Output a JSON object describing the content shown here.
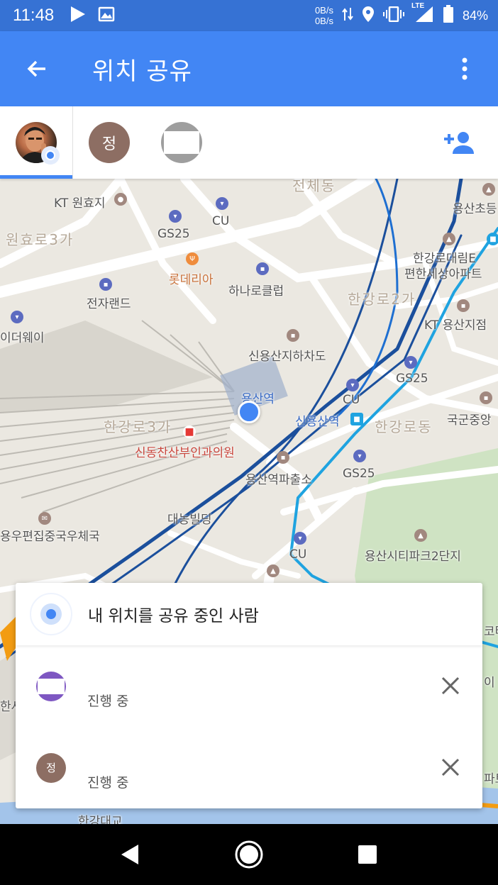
{
  "status_bar": {
    "time": "11:48",
    "net_up": "0B/s",
    "net_down": "0B/s",
    "network_type": "LTE",
    "battery": "84%",
    "icons": [
      "play-icon",
      "image-icon",
      "data-transfer-icon",
      "location-icon",
      "vibrate-icon",
      "signal-icon",
      "battery-icon"
    ]
  },
  "app_bar": {
    "title": "위치 공유",
    "back_icon": "arrow-back-icon",
    "more_icon": "more-vert-icon"
  },
  "people": [
    {
      "initial": "",
      "type": "self-photo",
      "selected": true
    },
    {
      "initial": "정",
      "type": "initial",
      "color": "#8d6e63"
    },
    {
      "initial": "",
      "type": "blank",
      "color": "#9e9e9e"
    }
  ],
  "add_person_icon": "person-add-icon",
  "map": {
    "labels": {
      "kt_wonhyo": "KT 원효지",
      "wonhyo_3ga": "원효로3가",
      "gs25_1": "GS25",
      "cu_1": "CU",
      "lotteria": "롯데리아",
      "hana": "하나로클럽",
      "jeonja": "전자랜드",
      "ideo": "이더웨이",
      "hangang_2ga": "한강로2가",
      "kt_yongsan": "KT 용산지점",
      "hangang_dae": "한강로대림E",
      "pyeonhan": "편한세상아파트",
      "yongsan_cho": "용산초등",
      "sinyongsan_underpass": "신용산지하차도",
      "yongsan_station": "용산역",
      "cu_2": "CU",
      "sinyongsan_station": "신용산역",
      "hangang_dong": "한강로동",
      "gukgun": "국군중앙",
      "gs25_2": "GS25",
      "hangang_3ga": "한강로3가",
      "clinic": "신동찬산부인과의원",
      "police": "용산역파출소",
      "gs25_3": "GS25",
      "daenong": "대농빌딩",
      "post": "용우편집중국우체국",
      "cu_3": "CU",
      "citypark": "용산시티파크2단지",
      "top_area": "전체동",
      "bridge": "한강대교",
      "right_edge_1": "코타",
      "right_edge_2": "이",
      "right_edge_3": "파트",
      "left_edge": "한사"
    }
  },
  "share_panel": {
    "header_title": "내 위치를 공유 중인 사람",
    "rows": [
      {
        "avatar_initial": "",
        "avatar_color": "#7e57c2",
        "status": "진행 중",
        "close_icon": "close-icon"
      },
      {
        "avatar_initial": "정",
        "avatar_color": "#8d6e63",
        "status": "진행 중",
        "close_icon": "close-icon"
      }
    ]
  },
  "nav_bar": {
    "back": "nav-back-icon",
    "home": "nav-home-icon",
    "recents": "nav-recents-icon"
  }
}
